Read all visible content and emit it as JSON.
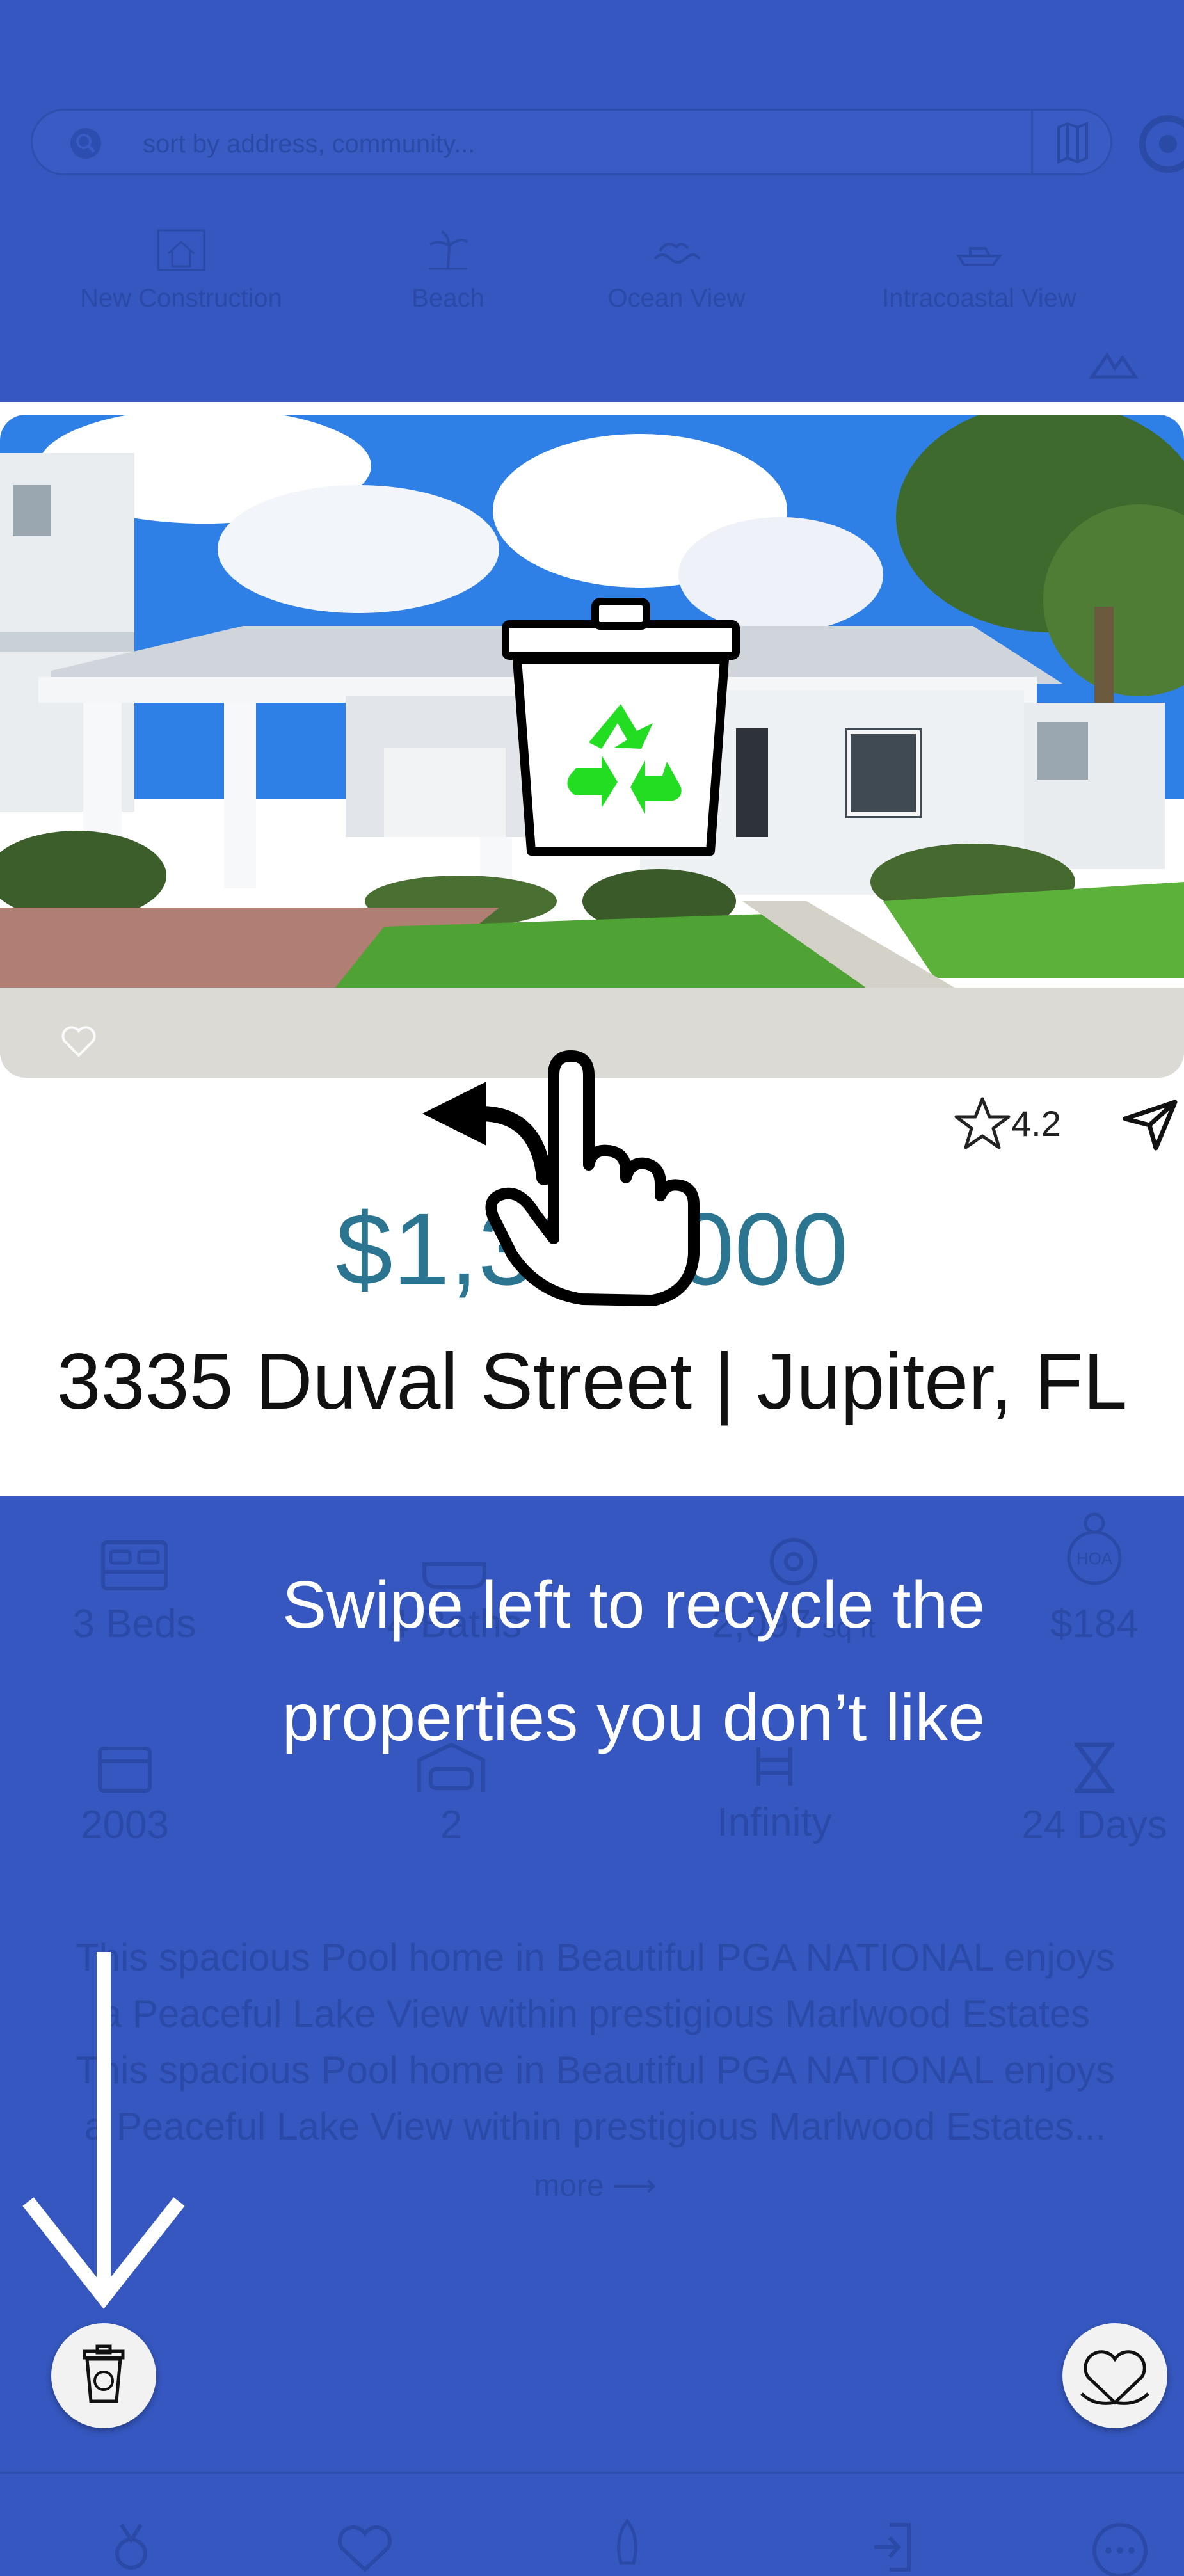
{
  "search": {
    "placeholder": "sort by address, community..."
  },
  "categories": [
    {
      "label": "New Construction",
      "icon": "house-icon"
    },
    {
      "label": "Beach",
      "icon": "palm-tree-icon"
    },
    {
      "label": "Ocean View",
      "icon": "wave-icon"
    },
    {
      "label": "Intracoastal View",
      "icon": "boat-icon"
    }
  ],
  "listing": {
    "rating": "4.2",
    "price": "$1,395,000",
    "address": "3335 Duval Street | Jupiter, FL"
  },
  "stats": [
    {
      "value": "3 Beds",
      "icon": "bed-icon"
    },
    {
      "value": "4 Baths",
      "icon": "bath-icon"
    },
    {
      "value": "2,097",
      "unit": "sq ft",
      "icon": "tape-measure-icon"
    },
    {
      "value": "$184",
      "icon": "hoa-icon"
    },
    {
      "value": "2003",
      "icon": "calendar-icon"
    },
    {
      "value": "2",
      "icon": "garage-icon"
    },
    {
      "value": "Infinity",
      "icon": "pool-icon"
    },
    {
      "value": "24 Days",
      "icon": "hourglass-icon"
    }
  ],
  "description": {
    "text": "This spacious Pool home in Beautiful PGA NATIONAL enjoys a Peaceful Lake View within prestigious Marlwood Estates This spacious Pool home in Beautiful PGA NATIONAL enjoys a Peaceful Lake View within prestigious Marlwood Estates...",
    "more": "more"
  },
  "overlay": {
    "line1": "Swipe left to recycle the",
    "line2": "properties you don’t like"
  },
  "colors": {
    "background": "#3557bf",
    "price": "#2b7590",
    "recycle_green": "#22dd22"
  }
}
